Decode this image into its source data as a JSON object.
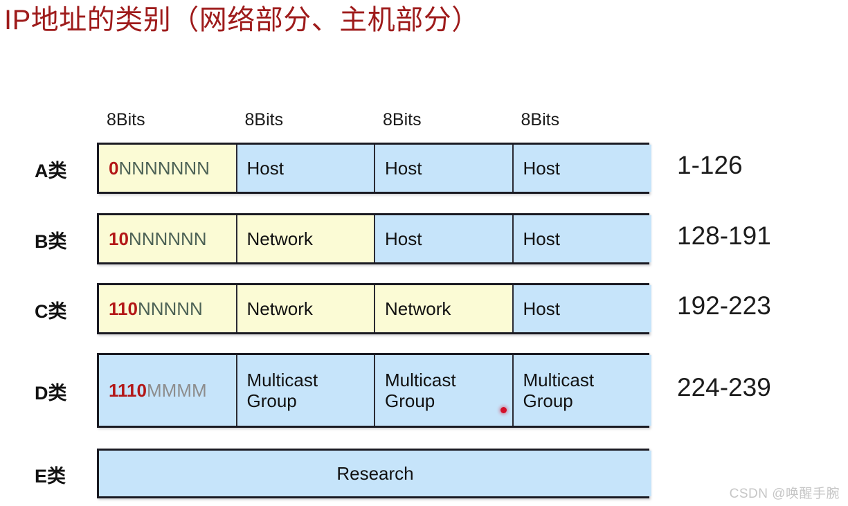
{
  "slide": {
    "title": "IP地址的类别（网络部分、主机部分）",
    "title_color": "#9e1b1b"
  },
  "colors": {
    "network_cell": "#fbfbd5",
    "host_cell": "#c6e4fa",
    "prefix_bits": "#b31717",
    "network_letters": "#4d6256",
    "multicast_letters": "#8d8d8d",
    "border": "#1a1a22"
  },
  "column_headers": [
    {
      "label": "8Bits"
    },
    {
      "label": "8Bits"
    },
    {
      "label": "8Bits"
    },
    {
      "label": "8Bits"
    }
  ],
  "rows": [
    {
      "class_label": "A类",
      "range": "1-126",
      "prefix": "0",
      "suffix": "NNNNNNN",
      "suffix_kind": "network",
      "cells": [
        {
          "text": "",
          "fill": "yellow"
        },
        {
          "text": "Host",
          "fill": "blue"
        },
        {
          "text": "Host",
          "fill": "blue"
        },
        {
          "text": "Host",
          "fill": "blue"
        }
      ]
    },
    {
      "class_label": "B类",
      "range": "128-191",
      "prefix": "10",
      "suffix": "NNNNNN",
      "suffix_kind": "network",
      "cells": [
        {
          "text": "",
          "fill": "yellow"
        },
        {
          "text": "Network",
          "fill": "yellow"
        },
        {
          "text": "Host",
          "fill": "blue"
        },
        {
          "text": "Host",
          "fill": "blue"
        }
      ]
    },
    {
      "class_label": "C类",
      "range": "192-223",
      "prefix": "110",
      "suffix": "NNNNN",
      "suffix_kind": "network",
      "cells": [
        {
          "text": "",
          "fill": "yellow"
        },
        {
          "text": "Network",
          "fill": "yellow"
        },
        {
          "text": "Network",
          "fill": "yellow"
        },
        {
          "text": "Host",
          "fill": "blue"
        }
      ]
    },
    {
      "class_label": "D类",
      "range": "224-239",
      "prefix": "1110",
      "suffix": "MMMM",
      "suffix_kind": "multicast",
      "cells": [
        {
          "text": "",
          "fill": "blue"
        },
        {
          "text": "Multicast\nGroup",
          "fill": "blue"
        },
        {
          "text": "Multicast\nGroup",
          "fill": "blue"
        },
        {
          "text": "Multicast\nGroup",
          "fill": "blue"
        }
      ]
    },
    {
      "class_label": "E类",
      "range": "",
      "prefix": "",
      "suffix": "",
      "suffix_kind": "",
      "cells": [
        {
          "text": "Research",
          "fill": "blue",
          "span": 4,
          "align": "center"
        }
      ]
    }
  ],
  "annotations": {
    "laser_pointer": "red-dot"
  },
  "watermark": {
    "text": "CSDN @唤醒手腕"
  }
}
